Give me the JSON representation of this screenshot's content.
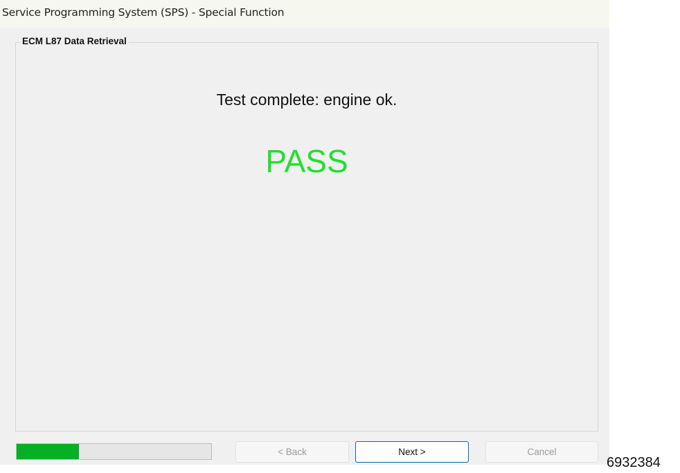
{
  "window": {
    "title": "Service Programming System (SPS) - Special Function"
  },
  "group": {
    "label": "ECM L87 Data Retrieval"
  },
  "status": {
    "message": "Test complete: engine ok.",
    "result": "PASS",
    "result_color": "#22e02a"
  },
  "progress": {
    "fraction": 0.32,
    "fill_color": "#06b025"
  },
  "buttons": {
    "back": "< Back",
    "next": "Next >",
    "cancel": "Cancel"
  },
  "reference": {
    "number": "6932384"
  }
}
